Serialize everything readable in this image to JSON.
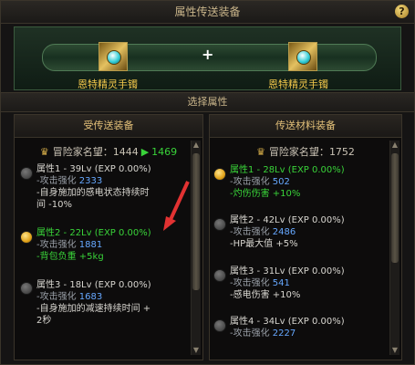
{
  "title": "属性传送装备",
  "help": "?",
  "banner": {
    "left_item": "恩特精灵手镯",
    "right_item": "恩特精灵手镯",
    "plus": "+"
  },
  "section_title": "选择属性",
  "left_panel": {
    "header": "受传送装备",
    "reputation_label": "冒险家名望：",
    "reputation_value": "1444",
    "reputation_next": "1469",
    "entries": [
      {
        "title": "属性1 - 39Lv (EXP 0.00%)",
        "lines": [
          "-攻击强化 2333",
          "-自身施加的感电状态持续时",
          "间 -10%"
        ],
        "selected": false
      },
      {
        "title": "属性2 - 22Lv (EXP 0.00%)",
        "lines": [
          "-攻击强化 1881",
          "-背包负重 +5kg"
        ],
        "selected": true
      },
      {
        "title": "属性3 - 18Lv (EXP 0.00%)",
        "lines": [
          "-攻击强化 1683",
          "-自身施加的减速持续时间 +",
          "2秒"
        ],
        "selected": false
      }
    ]
  },
  "right_panel": {
    "header": "传送材料装备",
    "reputation_label": "冒险家名望：",
    "reputation_value": "1752",
    "entries": [
      {
        "title": "属性1 - 28Lv (EXP 0.00%)",
        "lines": [
          "-攻击强化 502",
          "-灼伤伤害 +10%"
        ],
        "selected": true
      },
      {
        "title": "属性2 - 42Lv (EXP 0.00%)",
        "lines": [
          "-攻击强化 2486",
          "-HP最大值 +5%"
        ],
        "selected": false
      },
      {
        "title": "属性3 - 31Lv (EXP 0.00%)",
        "lines": [
          "-攻击强化 541",
          "-感电伤害 +10%"
        ],
        "selected": false
      },
      {
        "title": "属性4 - 34Lv (EXP 0.00%)",
        "lines": [
          "-攻击强化 2227"
        ],
        "selected": false
      }
    ]
  }
}
